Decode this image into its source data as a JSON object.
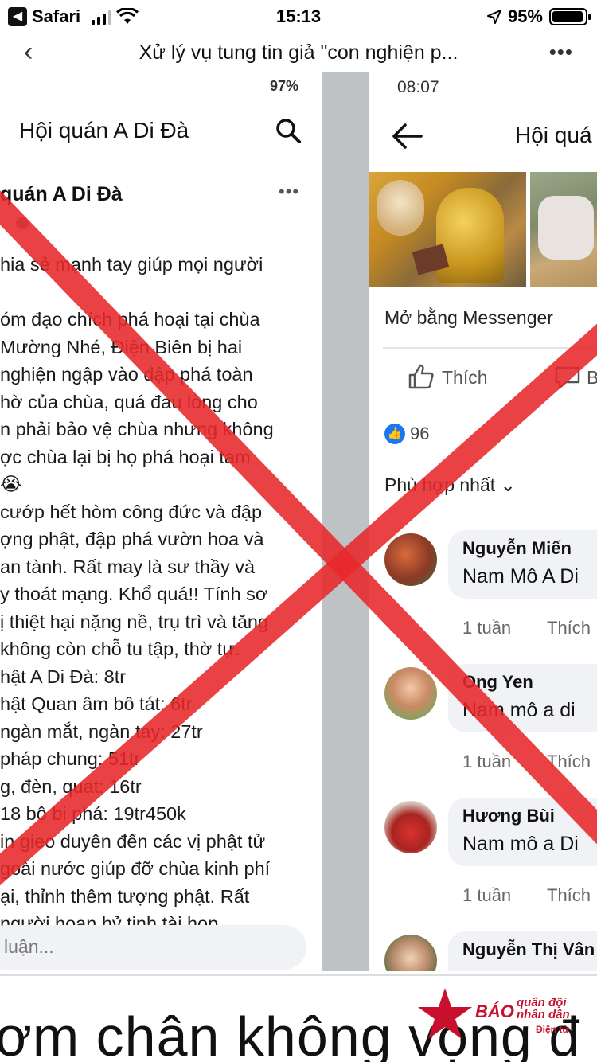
{
  "status_bar": {
    "back_app": "Safari",
    "time": "15:13",
    "battery_percent": "95%",
    "battery_level": 0.95
  },
  "nav": {
    "back_glyph": "‹",
    "title": "Xử lý vụ tung tin giả \"con nghiện p...",
    "more_glyph": "•••"
  },
  "screenshot_left": {
    "status": "97%",
    "header_title": "Hội quán A Di Đà",
    "page_name": "quán A Di Đà",
    "more_glyph": "•••",
    "body_lines": [
      "hia sẻ mạnh tay giúp mọi người",
      "",
      "óm đạo chích phá hoại  tại chùa",
      " Mường Nhé, Điện Biên bị hai",
      " nghiện ngập vào đập phá toàn",
      " hờ của chùa, quá đau lòng cho",
      "n phải bảo vệ chùa nhưng không",
      "ợc chùa lại bị họ phá hoại tam",
      " 😭",
      " cướp hết hòm công đức và đập",
      "ợng phật, đập phá vườn hoa và",
      "an tành. Rất may là sư thầy và",
      "y thoát mạng. Khổ quá!! Tính sơ",
      "ị thiệt hại nặng nề, trụ trì và tăng",
      " không còn chỗ tu tập, thờ tự.",
      "hật A Di Đà: 8tr",
      "hật Quan âm bô tát: 6tr",
      "ngàn mắt, ngàn tay: 27tr",
      " pháp chung: 51tr",
      "g, đèn, quạt: 16tr",
      " 18 bộ bị phá: 19tr450k",
      "in gieo duyên đến các vị phật tử",
      "goài nước giúp đỡ chùa kinh phí",
      "ại, thỉnh thêm tượng phật. Rất",
      "người hoan hỷ tịnh tài hop"
    ],
    "comment_placeholder": "luận..."
  },
  "screenshot_right": {
    "time": "08:07",
    "header_title": "Hội quá",
    "messenger_text": "Mở bằng Messenger",
    "like_label": "Thích",
    "comment_label": "B",
    "reaction_count": "96",
    "sort_label": "Phù hợp nhất ⌄",
    "comments": [
      {
        "name": "Nguyễn Miến",
        "text": "Nam Mô A Di",
        "time": "1 tuần",
        "like": "Thích"
      },
      {
        "name": "Ong Yen",
        "text": "Nam mô a di",
        "time": "1 tuần",
        "like": "Thích"
      },
      {
        "name": "Hương Bùi",
        "text": "Nam mô a Di",
        "time": "1 tuần",
        "like": "Thích"
      },
      {
        "name": "Nguyễn Thị Vân",
        "text": "",
        "time": "",
        "like": ""
      }
    ]
  },
  "caption": "ơm chân không vọng đ",
  "logo": {
    "line1": "BÁO",
    "line2a": "quân đội",
    "line2b": "nhân dân",
    "line3": "Điện tử",
    "color": "#c8102e"
  },
  "colors": {
    "cross_red": "#e8282b",
    "facebook_blue": "#1877f2"
  }
}
